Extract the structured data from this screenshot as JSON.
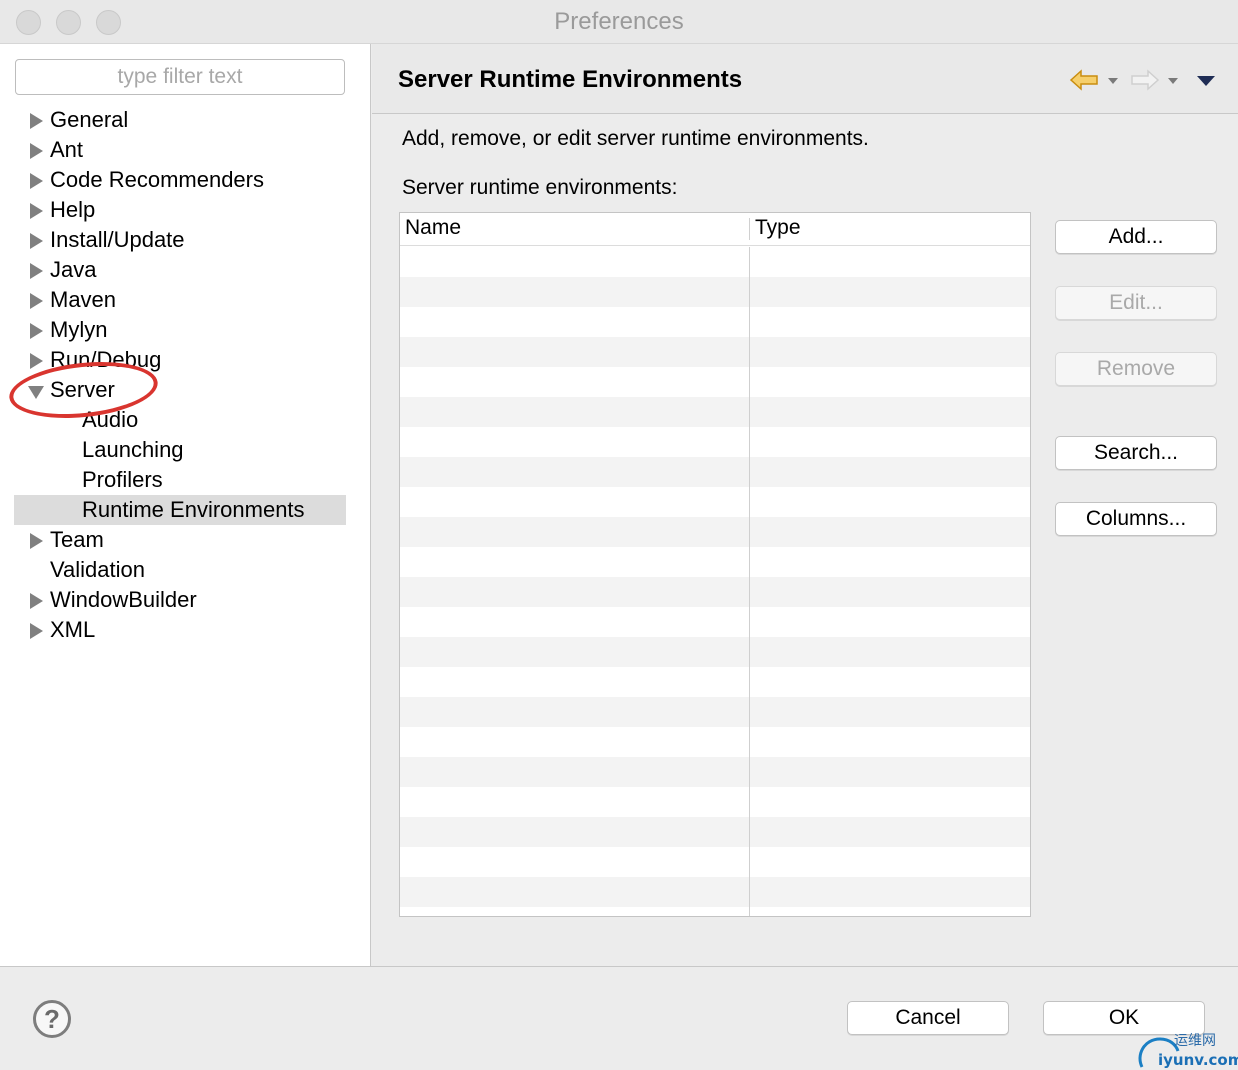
{
  "window": {
    "title": "Preferences"
  },
  "sidebar": {
    "filter_placeholder": "type filter text",
    "items": [
      {
        "label": "General",
        "expandable": true,
        "expanded": false,
        "level": 0
      },
      {
        "label": "Ant",
        "expandable": true,
        "expanded": false,
        "level": 0
      },
      {
        "label": "Code Recommenders",
        "expandable": true,
        "expanded": false,
        "level": 0
      },
      {
        "label": "Help",
        "expandable": true,
        "expanded": false,
        "level": 0
      },
      {
        "label": "Install/Update",
        "expandable": true,
        "expanded": false,
        "level": 0
      },
      {
        "label": "Java",
        "expandable": true,
        "expanded": false,
        "level": 0
      },
      {
        "label": "Maven",
        "expandable": true,
        "expanded": false,
        "level": 0
      },
      {
        "label": "Mylyn",
        "expandable": true,
        "expanded": false,
        "level": 0
      },
      {
        "label": "Run/Debug",
        "expandable": true,
        "expanded": false,
        "level": 0
      },
      {
        "label": "Server",
        "expandable": true,
        "expanded": true,
        "level": 0
      },
      {
        "label": "Audio",
        "expandable": false,
        "expanded": false,
        "level": 1
      },
      {
        "label": "Launching",
        "expandable": false,
        "expanded": false,
        "level": 1
      },
      {
        "label": "Profilers",
        "expandable": false,
        "expanded": false,
        "level": 1
      },
      {
        "label": "Runtime Environments",
        "expandable": false,
        "expanded": false,
        "level": 1,
        "selected": true
      },
      {
        "label": "Team",
        "expandable": true,
        "expanded": false,
        "level": 0
      },
      {
        "label": "Validation",
        "expandable": false,
        "expanded": false,
        "level": 0
      },
      {
        "label": "WindowBuilder",
        "expandable": true,
        "expanded": false,
        "level": 0
      },
      {
        "label": "XML",
        "expandable": true,
        "expanded": false,
        "level": 0
      }
    ]
  },
  "page": {
    "title": "Server Runtime Environments",
    "description": "Add, remove, or edit server runtime environments.",
    "list_label": "Server runtime environments:",
    "table": {
      "columns": [
        "Name",
        "Type"
      ],
      "rows": []
    },
    "buttons": {
      "add": "Add...",
      "edit": "Edit...",
      "remove": "Remove",
      "search": "Search...",
      "columns": "Columns..."
    }
  },
  "footer": {
    "cancel": "Cancel",
    "ok": "OK"
  },
  "colors": {
    "annotation": "#d9352f",
    "back_arrow": "#f0b429",
    "selection": "#dcdcdc"
  },
  "icons": {
    "back": "back-arrow-icon",
    "forward": "forward-arrow-icon",
    "view_menu": "view-menu-icon",
    "help": "help-icon"
  }
}
